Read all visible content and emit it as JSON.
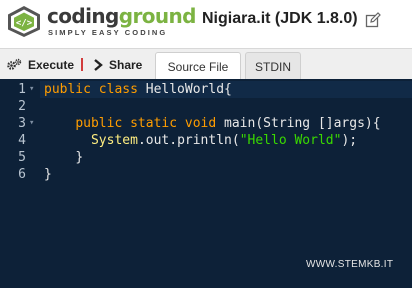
{
  "header": {
    "brand_part1": "coding",
    "brand_part2": "ground",
    "tagline": "SIMPLY EASY CODING",
    "project_title": "Nigiara.it (JDK 1.8.0)"
  },
  "toolbar": {
    "execute_label": "Execute",
    "share_label": "Share",
    "tabs": [
      {
        "label": "Source File",
        "active": true
      },
      {
        "label": "STDIN",
        "active": false
      }
    ]
  },
  "editor": {
    "line_numbers": [
      "1",
      "2",
      "3",
      "4",
      "5",
      "6"
    ],
    "lines": [
      {
        "kw": "public class ",
        "text": "HelloWorld{"
      },
      {
        "text": ""
      },
      {
        "indent": "    ",
        "kw": "public static void ",
        "text": "main(String []args){"
      },
      {
        "indent": "      ",
        "obj": "System",
        "text": ".out.println(",
        "str": "\"Hello World\"",
        "tail": ");"
      },
      {
        "indent": "    ",
        "text": "}"
      },
      {
        "text": "}"
      }
    ]
  },
  "watermark": "WWW.STEMKB.IT",
  "colors": {
    "editor_bg": "#0d2138",
    "keyword": "#ff9d00",
    "string": "#3ad900",
    "brand_green": "#7cb342",
    "separator_red": "#d23c3c"
  }
}
